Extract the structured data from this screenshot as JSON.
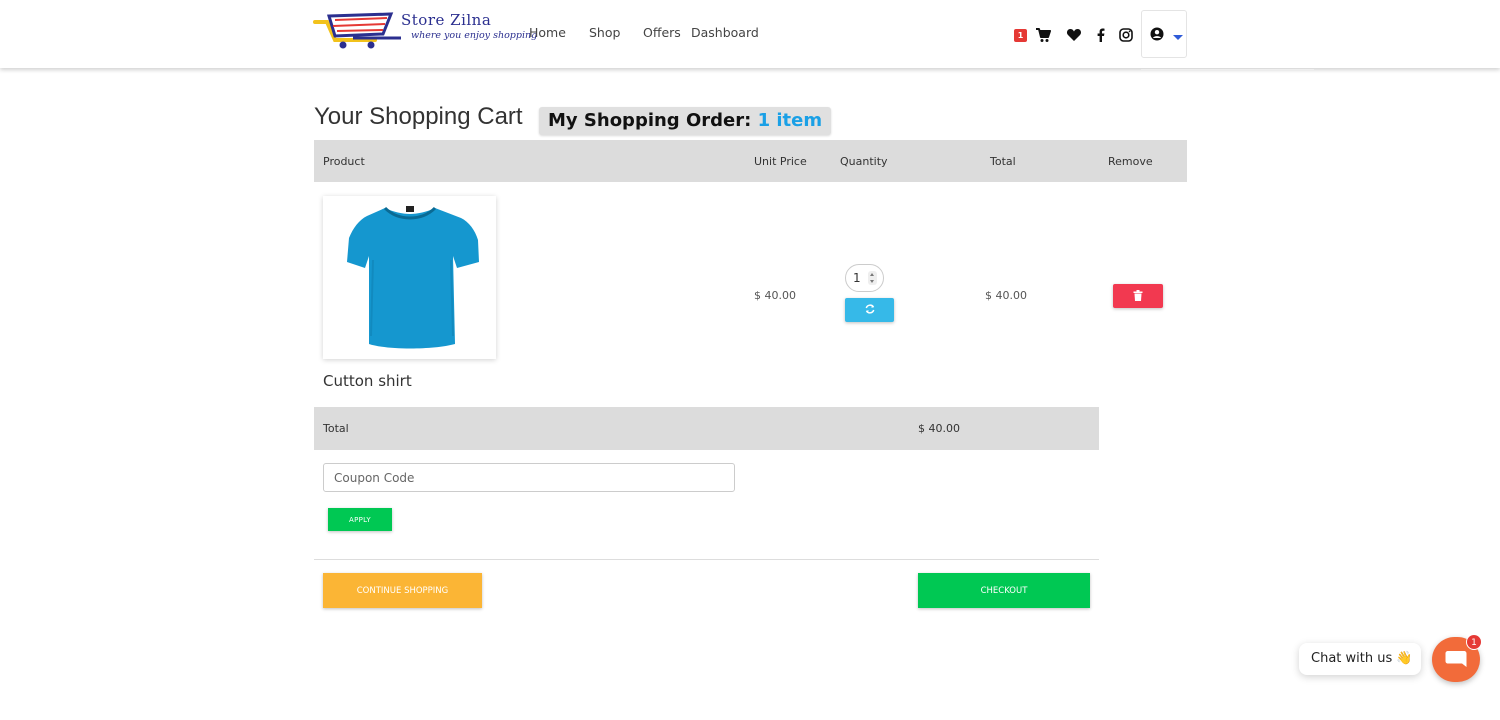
{
  "header": {
    "logo": {
      "brand": "Store Zilna",
      "tagline": "where you enjoy shopping"
    },
    "nav": {
      "home": "Home",
      "shop": "Shop",
      "offers": "Offers",
      "dashboard": "Dashboard"
    },
    "cart_count": "1",
    "icons": [
      "cart-icon",
      "heart-icon",
      "facebook-icon",
      "instagram-icon",
      "user-circle-icon",
      "caret-down-icon"
    ]
  },
  "page": {
    "title": "Your Shopping Cart",
    "order_label": "My Shopping Order:",
    "order_count": "1 item"
  },
  "table": {
    "columns": {
      "product": "Product",
      "unit_price": "Unit Price",
      "quantity": "Quantity",
      "total": "Total",
      "remove": "Remove"
    },
    "rows": [
      {
        "name": "Cutton shirt",
        "unit_price": "$ 40.00",
        "quantity": "1",
        "total": "$ 40.00"
      }
    ]
  },
  "summary": {
    "label": "Total",
    "value": "$ 40.00"
  },
  "coupon": {
    "placeholder": "Coupon Code",
    "apply_label": "APPLY"
  },
  "actions": {
    "continue": "CONTINUE SHOPPING",
    "checkout": "CHECKOUT"
  },
  "chat": {
    "label": "Chat with us 👋",
    "badge": "1"
  },
  "colors": {
    "accent_blue": "#1aa0e6",
    "green": "#00c853",
    "orange": "#fbb535",
    "red": "#f23950",
    "chat": "#f26b3a"
  }
}
